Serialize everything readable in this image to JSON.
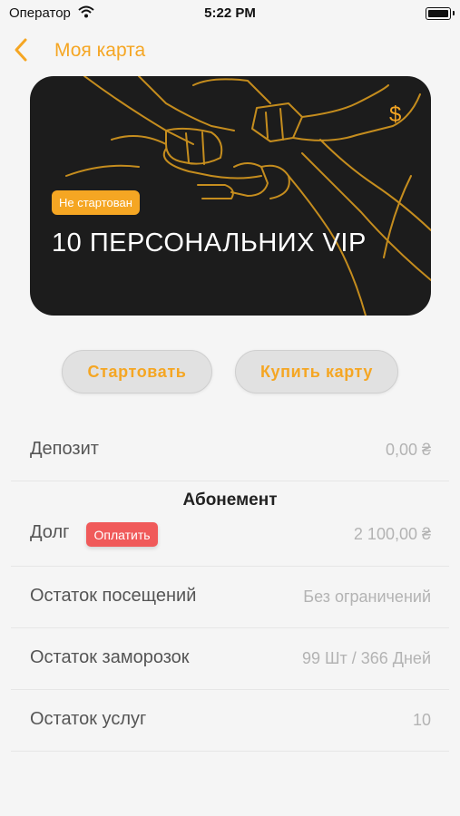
{
  "status_bar": {
    "carrier": "Оператор",
    "time": "5:22 PM"
  },
  "nav": {
    "title": "Моя карта"
  },
  "card": {
    "status_badge": "Не стартован",
    "title": "10 ПЕРСОНАЛЬНИХ VIP",
    "currency_icon": "$"
  },
  "actions": {
    "start_label": "Стартовать",
    "buy_label": "Купить карту"
  },
  "deposit": {
    "label": "Депозит",
    "value": "0,00 ₴"
  },
  "subscription": {
    "section_title": "Абонемент",
    "debt_label": "Долг",
    "pay_label": "Оплатить",
    "debt_value": "2 100,00 ₴",
    "visits_label": "Остаток посещений",
    "visits_value": "Без ограничений",
    "freezes_label": "Остаток заморозок",
    "freezes_value": "99 Шт / 366 Дней",
    "services_label": "Остаток услуг",
    "services_value": "10"
  },
  "colors": {
    "accent": "#f5a623",
    "danger": "#f05a5a",
    "card_bg": "#1c1c1c"
  }
}
